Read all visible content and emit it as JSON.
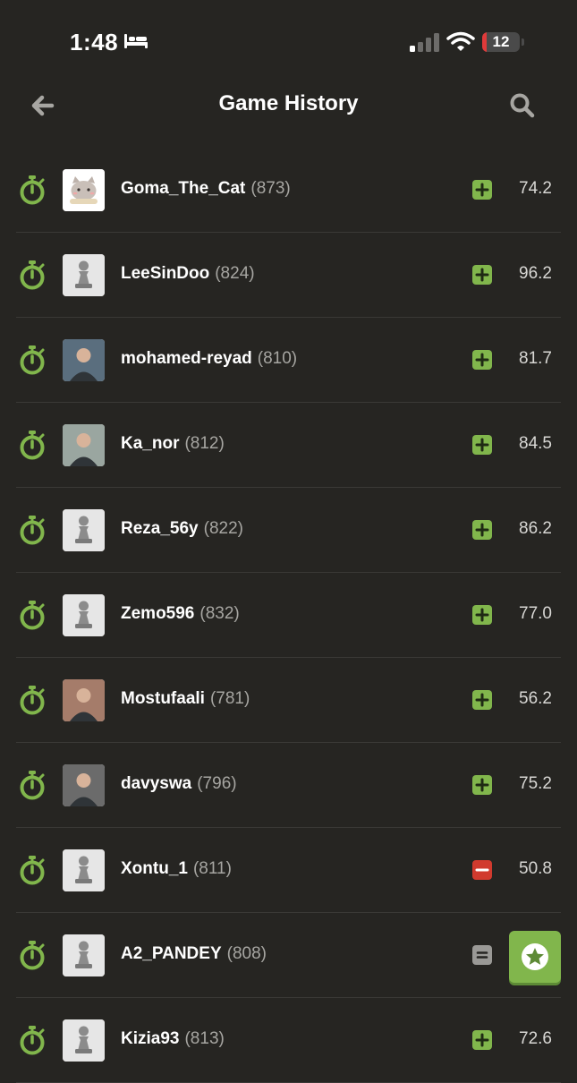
{
  "status_bar": {
    "time": "1:48",
    "battery": "12",
    "battery_level": 0.12,
    "icons": [
      "sleep-bed-icon",
      "cellular-signal-icon",
      "wifi-icon",
      "battery-icon"
    ]
  },
  "header": {
    "title": "Game History",
    "back_icon": "arrow-left-icon",
    "search_icon": "search-icon"
  },
  "games": [
    {
      "name": "Goma_The_Cat",
      "rating": "(873)",
      "result": "win",
      "accuracy": "74.2",
      "avatar": "cat-avatar"
    },
    {
      "name": "LeeSinDoo",
      "rating": "(824)",
      "result": "win",
      "accuracy": "96.2",
      "avatar": "default-pawn-avatar"
    },
    {
      "name": "mohamed-reyad",
      "rating": "(810)",
      "result": "win",
      "accuracy": "81.7",
      "avatar": "photo-avatar"
    },
    {
      "name": "Ka_nor",
      "rating": "(812)",
      "result": "win",
      "accuracy": "84.5",
      "avatar": "photo-avatar"
    },
    {
      "name": "Reza_56y",
      "rating": "(822)",
      "result": "win",
      "accuracy": "86.2",
      "avatar": "default-pawn-avatar"
    },
    {
      "name": "Zemo596",
      "rating": "(832)",
      "result": "win",
      "accuracy": "77.0",
      "avatar": "default-pawn-avatar"
    },
    {
      "name": "Mostufaali",
      "rating": "(781)",
      "result": "win",
      "accuracy": "56.2",
      "avatar": "photo-avatar"
    },
    {
      "name": "davyswa",
      "rating": "(796)",
      "result": "win",
      "accuracy": "75.2",
      "avatar": "photo-avatar"
    },
    {
      "name": "Xontu_1",
      "rating": "(811)",
      "result": "loss",
      "accuracy": "50.8",
      "avatar": "default-pawn-avatar"
    },
    {
      "name": "A2_PANDEY",
      "rating": "(808)",
      "result": "draw",
      "accuracy": "",
      "avatar": "default-pawn-avatar"
    },
    {
      "name": "Kizia93",
      "rating": "(813)",
      "result": "win",
      "accuracy": "72.6",
      "avatar": "default-pawn-avatar"
    }
  ],
  "fab": {
    "icon": "star-icon"
  },
  "colors": {
    "background": "#262522",
    "win": "#81b64c",
    "loss": "#d13a2e",
    "draw": "#9a9996",
    "timer": "#81b64c"
  }
}
